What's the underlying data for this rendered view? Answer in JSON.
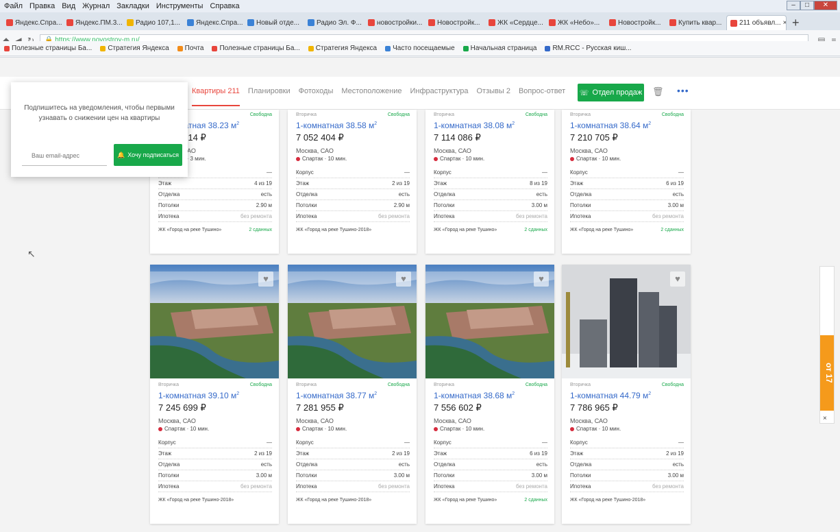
{
  "browser": {
    "menu": [
      "Файл",
      "Правка",
      "Вид",
      "Журнал",
      "Закладки",
      "Инструменты",
      "Справка"
    ],
    "tabs": [
      {
        "label": "Яндекс.Спра...",
        "color": "#e8453c"
      },
      {
        "label": "Яндекс.ПМ.3...",
        "color": "#e8453c"
      },
      {
        "label": "Радио 107,1...",
        "color": "#f0b400"
      },
      {
        "label": "Яндекс.Спра...",
        "color": "#3b82d6"
      },
      {
        "label": "Новый отде...",
        "color": "#3b82d6"
      },
      {
        "label": "Радио Эл. Ф...",
        "color": "#3b82d6"
      },
      {
        "label": "новостройки...",
        "color": "#e8453c"
      },
      {
        "label": "Новостройк...",
        "color": "#e8453c"
      },
      {
        "label": "ЖК «Сердце...",
        "color": "#e8453c"
      },
      {
        "label": "ЖК «Небо»...",
        "color": "#e8453c"
      },
      {
        "label": "Новостройк...",
        "color": "#e8453c"
      },
      {
        "label": "Купить квар...",
        "color": "#e8453c"
      },
      {
        "label": "211 объявл...",
        "color": "#e8453c"
      }
    ],
    "url": "https://www.novostroy-m.ru/",
    "bookmarks": [
      "Полезные страницы Ба...",
      "Стратегия Яндекса",
      "Почта",
      "Полезные страницы Ба...",
      "Стратегия Яндекса",
      "Часто посещаемые",
      "Начальная страница",
      "RM.RCC - Русская киш..."
    ]
  },
  "subnav": {
    "links": [
      "Квартиры 211",
      "Планировки",
      "Фотоходы",
      "Местоположение",
      "Инфраструктура",
      "Отзывы 2",
      "Вопрос-ответ"
    ],
    "order_call": "Отдел продаж"
  },
  "popup": {
    "text": "Подпишитесь на уведомления, чтобы первыми узнавать о снижении цен на квартиры",
    "placeholder": "Ваш email-адрес",
    "button": "Хочу подписаться"
  },
  "cards": [
    {
      "type": "Вторичка",
      "status": "Свободна",
      "title": "1-комнатная 38.23 м",
      "price": "7 0__ 514 ₽",
      "district": "Москва, САО",
      "metro": "Спартак · 3 мин.",
      "floor": "4 из 19",
      "finish": "есть",
      "ceiling": "2.90 м",
      "mortgage": "без ремонта",
      "complex": "ЖК «Город на реке Тушино»",
      "tag": "2 сданных",
      "row": 0,
      "col": 0,
      "photo": "none"
    },
    {
      "type": "Вторичка",
      "status": "Свободна",
      "title": "1-комнатная 38.58 м",
      "price": "7 052 404 ₽",
      "district": "Москва, САО",
      "metro": "Спартак · 10 мин.",
      "floor": "2 из 19",
      "finish": "есть",
      "ceiling": "2.90 м",
      "mortgage": "без ремонта",
      "complex": "ЖК «Город на реке Тушино-2018»",
      "tag": "",
      "row": 0,
      "col": 1,
      "photo": "none"
    },
    {
      "type": "Вторичка",
      "status": "Свободна",
      "title": "1-комнатная 38.08 м",
      "price": "7 114 086 ₽",
      "district": "Москва, САО",
      "metro": "Спартак · 10 мин.",
      "floor": "8 из 19",
      "finish": "есть",
      "ceiling": "3.00 м",
      "mortgage": "без ремонта",
      "complex": "ЖК «Город на реке Тушино»",
      "tag": "2 сданных",
      "row": 0,
      "col": 2,
      "photo": "none"
    },
    {
      "type": "Вторичка",
      "status": "Свободна",
      "title": "1-комнатная 38.64 м",
      "price": "7 210 705 ₽",
      "district": "Москва, САО",
      "metro": "Спартак · 10 мин.",
      "floor": "6 из 19",
      "finish": "есть",
      "ceiling": "3.00 м",
      "mortgage": "без ремонта",
      "complex": "ЖК «Город на реке Тушино»",
      "tag": "2 сданных",
      "row": 0,
      "col": 3,
      "photo": "none"
    },
    {
      "type": "Вторичка",
      "status": "Свободна",
      "title": "1-комнатная 39.10 м",
      "price": "7 245 699 ₽",
      "district": "Москва, САО",
      "metro": "Спартак · 10 мин.",
      "floor": "2 из 19",
      "finish": "есть",
      "ceiling": "3.00 м",
      "mortgage": "без ремонта",
      "complex": "ЖК «Город на реке Тушино-2018»",
      "tag": "",
      "row": 1,
      "col": 0,
      "photo": "aerial"
    },
    {
      "type": "Вторичка",
      "status": "Свободна",
      "title": "1-комнатная 38.77 м",
      "price": "7 281 955 ₽",
      "district": "Москва, САО",
      "metro": "Спартак · 10 мин.",
      "floor": "2 из 19",
      "finish": "есть",
      "ceiling": "3.00 м",
      "mortgage": "без ремонта",
      "complex": "ЖК «Город на реке Тушино-2018»",
      "tag": "",
      "row": 1,
      "col": 1,
      "photo": "aerial"
    },
    {
      "type": "Вторичка",
      "status": "Свободна",
      "title": "1-комнатная 38.68 м",
      "price": "7 556 602 ₽",
      "district": "Москва, САО",
      "metro": "Спартак · 10 мин.",
      "floor": "6 из 19",
      "finish": "есть",
      "ceiling": "3.00 м",
      "mortgage": "без ремонта",
      "complex": "ЖК «Город на реке Тушино»",
      "tag": "2 сданных",
      "row": 1,
      "col": 2,
      "photo": "aerial"
    },
    {
      "type": "Вторичка",
      "status": "Свободна",
      "title": "1-комнатная 44.79 м",
      "price": "7 786 965 ₽",
      "district": "Москва, САО",
      "metro": "Спартак · 10 мин.",
      "floor": "2 из 19",
      "finish": "есть",
      "ceiling": "3.00 м",
      "mortgage": "без ремонта",
      "complex": "ЖК «Город на реке Тушино-2018»",
      "tag": "",
      "row": 1,
      "col": 3,
      "photo": "tower"
    }
  ],
  "labels": {
    "corpus": "Корпус",
    "floor": "Этаж",
    "finish": "Отделка",
    "ceiling": "Потолки",
    "mortgage": "Ипотека",
    "area_unit": "2"
  },
  "ad": {
    "text": "от 17",
    "close": "×"
  },
  "colors": {
    "accent_green": "#18a84a",
    "link_blue": "#3469c9",
    "active_red": "#e8453c"
  }
}
